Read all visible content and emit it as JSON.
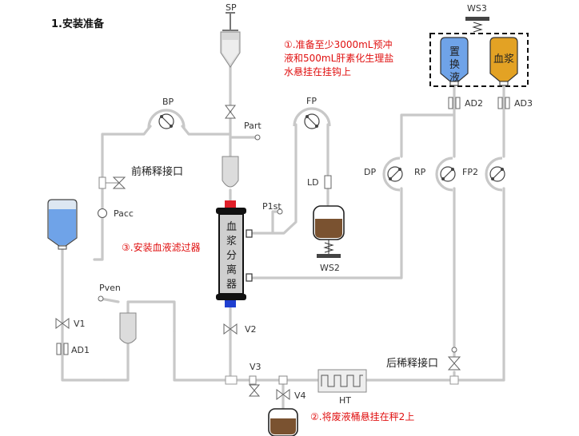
{
  "title": "1.安装准备",
  "notes": {
    "note1_line1": "①.准备至少3000mL预冲",
    "note1_line2": "液和500mL肝素化生理盐",
    "note1_line3": "水悬挂在挂钩上",
    "note2": "②.将废液桶悬挂在秤2上",
    "note3": "③.安装血液滤过器"
  },
  "labels": {
    "sp": "SP",
    "ws3": "WS3",
    "bp": "BP",
    "part": "Part",
    "fp": "FP",
    "ld": "LD",
    "p1st": "P1st",
    "ws2": "WS2",
    "pre_dilution": "前稀释接口",
    "pacc": "Pacc",
    "pven": "Pven",
    "v1": "V1",
    "ad1": "AD1",
    "v2": "V2",
    "v3": "V3",
    "v4": "V4",
    "ht": "HT",
    "post_dilution": "后稀释接口",
    "dp": "DP",
    "rp": "RP",
    "fp2": "FP2",
    "ad2": "AD2",
    "ad3": "AD3"
  },
  "bags": {
    "replacement_1": "置",
    "replacement_2": "换",
    "replacement_3": "液",
    "plasma": "血浆"
  },
  "separator": {
    "c1": "血",
    "c2": "浆",
    "c3": "分",
    "c4": "离",
    "c5": "器"
  },
  "colors": {
    "accent_red": "#e01010",
    "pipe_gray": "#c8c8c8",
    "fluid_blue": "#6fa3e8",
    "plasma_orange": "#e3a224",
    "waste_brown": "#7a5230",
    "connector_red": "#e0202a",
    "connector_blue": "#1f3fd0"
  }
}
